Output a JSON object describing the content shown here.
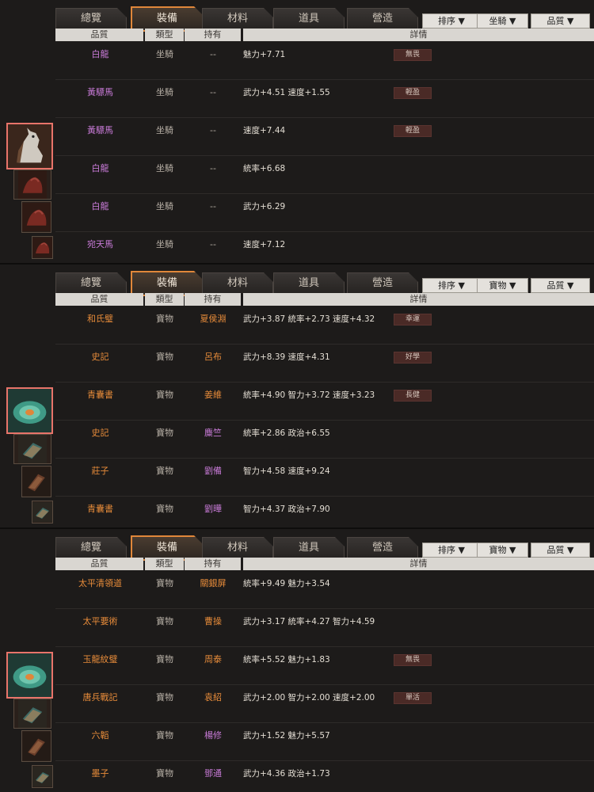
{
  "panels": [
    {
      "tabs": [
        "總覽",
        "裝備",
        "材料",
        "道具",
        "營造"
      ],
      "active_tab": "裝備",
      "dropdowns": [
        "排序 ▼",
        "坐騎 ▼",
        "品質 ▼"
      ],
      "headers": [
        "品質",
        "類型",
        "持有",
        "詳情"
      ],
      "rows": [
        {
          "name": "白龍",
          "type": "坐騎",
          "owner": "--",
          "detail": "魅力+7.71",
          "tag": "無畏",
          "name_color": "purple",
          "owner_color": "gray"
        },
        {
          "name": "黃驃馬",
          "type": "坐騎",
          "owner": "--",
          "detail": "武力+4.51 速度+1.55",
          "tag": "輕盈",
          "name_color": "purple",
          "owner_color": "gray"
        },
        {
          "name": "黃驃馬",
          "type": "坐騎",
          "owner": "--",
          "detail": "速度+7.44",
          "tag": "輕盈",
          "name_color": "purple",
          "owner_color": "gray"
        },
        {
          "name": "白龍",
          "type": "坐騎",
          "owner": "--",
          "detail": "統率+6.68",
          "tag": "",
          "name_color": "purple",
          "owner_color": "gray"
        },
        {
          "name": "白龍",
          "type": "坐騎",
          "owner": "--",
          "detail": "武力+6.29",
          "tag": "",
          "name_color": "purple",
          "owner_color": "gray"
        },
        {
          "name": "宛天馬",
          "type": "坐騎",
          "owner": "--",
          "detail": "速度+7.12",
          "tag": "",
          "name_color": "purple",
          "owner_color": "gray"
        }
      ],
      "thumb_kind": "horse"
    },
    {
      "tabs": [
        "總覽",
        "裝備",
        "材料",
        "道具",
        "營造"
      ],
      "active_tab": "裝備",
      "dropdowns": [
        "排序 ▼",
        "寶物 ▼",
        "品質 ▼"
      ],
      "headers": [
        "品質",
        "類型",
        "持有",
        "詳情"
      ],
      "rows": [
        {
          "name": "和氏璧",
          "type": "寶物",
          "owner": "夏侯淵",
          "detail": "武力+3.87 統率+2.73 速度+4.32",
          "tag": "幸運",
          "name_color": "orange",
          "owner_color": "orange"
        },
        {
          "name": "史記",
          "type": "寶物",
          "owner": "呂布",
          "detail": "武力+8.39 速度+4.31",
          "tag": "好學",
          "name_color": "orange",
          "owner_color": "orange"
        },
        {
          "name": "青囊書",
          "type": "寶物",
          "owner": "姜維",
          "detail": "統率+4.90 智力+3.72 速度+3.23",
          "tag": "長健",
          "name_color": "orange",
          "owner_color": "orange"
        },
        {
          "name": "史記",
          "type": "寶物",
          "owner": "麋竺",
          "detail": "統率+2.86 政治+6.55",
          "tag": "",
          "name_color": "orange",
          "owner_color": "purple"
        },
        {
          "name": "莊子",
          "type": "寶物",
          "owner": "劉備",
          "detail": "智力+4.58 速度+9.24",
          "tag": "",
          "name_color": "orange",
          "owner_color": "purple"
        },
        {
          "name": "青囊書",
          "type": "寶物",
          "owner": "劉曄",
          "detail": "智力+4.37 政治+7.90",
          "tag": "",
          "name_color": "orange",
          "owner_color": "purple"
        }
      ],
      "thumb_kind": "treasure"
    },
    {
      "tabs": [
        "總覽",
        "裝備",
        "材料",
        "道具",
        "營造"
      ],
      "active_tab": "裝備",
      "dropdowns": [
        "排序 ▼",
        "寶物 ▼",
        "品質 ▼"
      ],
      "headers": [
        "品質",
        "類型",
        "持有",
        "詳情"
      ],
      "rows": [
        {
          "name": "太平清領道",
          "type": "寶物",
          "owner": "關銀屏",
          "detail": "統率+9.49 魅力+3.54",
          "tag": "",
          "name_color": "orange",
          "owner_color": "orange"
        },
        {
          "name": "太平要術",
          "type": "寶物",
          "owner": "曹操",
          "detail": "武力+3.17 統率+4.27 智力+4.59",
          "tag": "",
          "name_color": "orange",
          "owner_color": "orange"
        },
        {
          "name": "玉龍紋璧",
          "type": "寶物",
          "owner": "周泰",
          "detail": "統率+5.52 魅力+1.83",
          "tag": "無畏",
          "name_color": "orange",
          "owner_color": "orange"
        },
        {
          "name": "唐兵戰記",
          "type": "寶物",
          "owner": "袁紹",
          "detail": "武力+2.00 智力+2.00 速度+2.00",
          "tag": "單活",
          "name_color": "orange",
          "owner_color": "orange"
        },
        {
          "name": "六韜",
          "type": "寶物",
          "owner": "楊修",
          "detail": "武力+1.52 魅力+5.57",
          "tag": "",
          "name_color": "orange",
          "owner_color": "purple"
        },
        {
          "name": "墨子",
          "type": "寶物",
          "owner": "鄧通",
          "detail": "武力+4.36 政治+1.73",
          "tag": "",
          "name_color": "orange",
          "owner_color": "purple"
        }
      ],
      "thumb_kind": "treasure"
    }
  ],
  "colors": {
    "accent": "#e0873a",
    "purple": "#c77ad6",
    "orange": "#e88c3a",
    "selected_border": "#e8746a"
  }
}
